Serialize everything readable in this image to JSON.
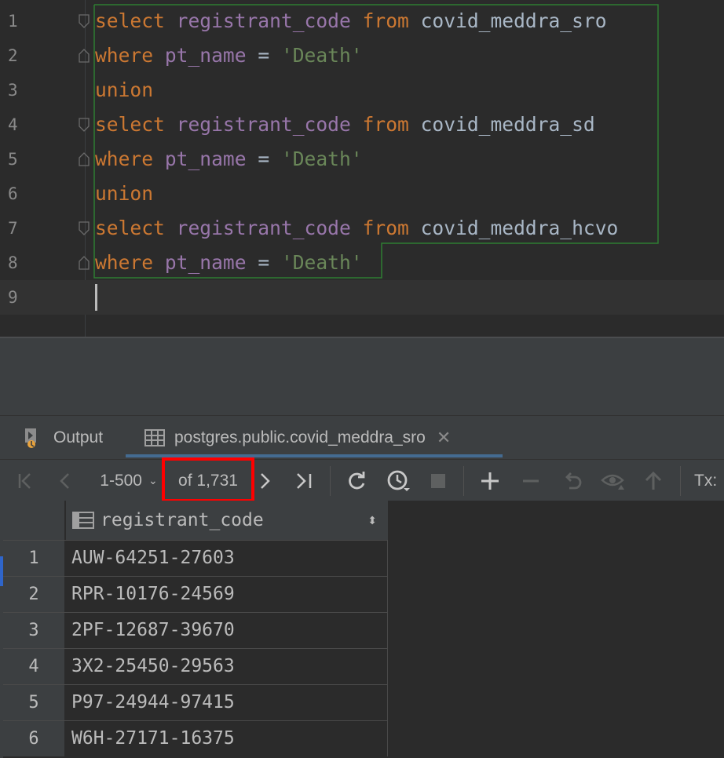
{
  "editor": {
    "lines": [
      {
        "num": "1",
        "tokens": [
          {
            "t": "select",
            "c": "kw"
          },
          {
            "t": " "
          },
          {
            "t": "registrant_code",
            "c": "col"
          },
          {
            "t": " "
          },
          {
            "t": "from",
            "c": "kw"
          },
          {
            "t": " "
          },
          {
            "t": "covid_meddra_sro",
            "c": "tbl"
          }
        ]
      },
      {
        "num": "2",
        "tokens": [
          {
            "t": "where",
            "c": "kw"
          },
          {
            "t": " "
          },
          {
            "t": "pt_name",
            "c": "col"
          },
          {
            "t": " = ",
            "c": "op"
          },
          {
            "t": "'Death'",
            "c": "str"
          }
        ]
      },
      {
        "num": "3",
        "tokens": [
          {
            "t": "union",
            "c": "kw"
          }
        ]
      },
      {
        "num": "4",
        "tokens": [
          {
            "t": "select",
            "c": "kw"
          },
          {
            "t": " "
          },
          {
            "t": "registrant_code",
            "c": "col"
          },
          {
            "t": " "
          },
          {
            "t": "from",
            "c": "kw"
          },
          {
            "t": " "
          },
          {
            "t": "covid_meddra_sd",
            "c": "tbl"
          }
        ]
      },
      {
        "num": "5",
        "tokens": [
          {
            "t": "where",
            "c": "kw"
          },
          {
            "t": " "
          },
          {
            "t": "pt_name",
            "c": "col"
          },
          {
            "t": " = ",
            "c": "op"
          },
          {
            "t": "'Death'",
            "c": "str"
          }
        ]
      },
      {
        "num": "6",
        "tokens": [
          {
            "t": "union",
            "c": "kw"
          }
        ]
      },
      {
        "num": "7",
        "tokens": [
          {
            "t": "select",
            "c": "kw"
          },
          {
            "t": " "
          },
          {
            "t": "registrant_code",
            "c": "col"
          },
          {
            "t": " "
          },
          {
            "t": "from",
            "c": "kw"
          },
          {
            "t": " "
          },
          {
            "t": "covid_meddra_hcvo",
            "c": "tbl"
          }
        ]
      },
      {
        "num": "8",
        "tokens": [
          {
            "t": "where",
            "c": "kw"
          },
          {
            "t": " "
          },
          {
            "t": "pt_name",
            "c": "col"
          },
          {
            "t": " = ",
            "c": "op"
          },
          {
            "t": "'Death'",
            "c": "str"
          }
        ]
      },
      {
        "num": "9",
        "tokens": []
      }
    ]
  },
  "tabs": {
    "output_label": "Output",
    "result_label": "postgres.public.covid_meddra_sro"
  },
  "toolbar": {
    "page_range": "1-500",
    "total_label": "of 1,731",
    "tx_label": "Tx:"
  },
  "grid": {
    "column_header": "registrant_code",
    "rows": [
      {
        "n": "1",
        "code": "AUW-64251-27603"
      },
      {
        "n": "2",
        "code": "RPR-10176-24569"
      },
      {
        "n": "3",
        "code": "2PF-12687-39670"
      },
      {
        "n": "4",
        "code": "3X2-25450-29563"
      },
      {
        "n": "5",
        "code": "P97-24944-97415"
      },
      {
        "n": "6",
        "code": "W6H-27171-16375"
      }
    ]
  },
  "colors": {
    "keyword": "#cc7832",
    "identifier": "#9876aa",
    "string": "#6a8759",
    "plain": "#a9b7c6",
    "highlight_box": "#ff0000",
    "selection_outline": "#2e7d32"
  }
}
